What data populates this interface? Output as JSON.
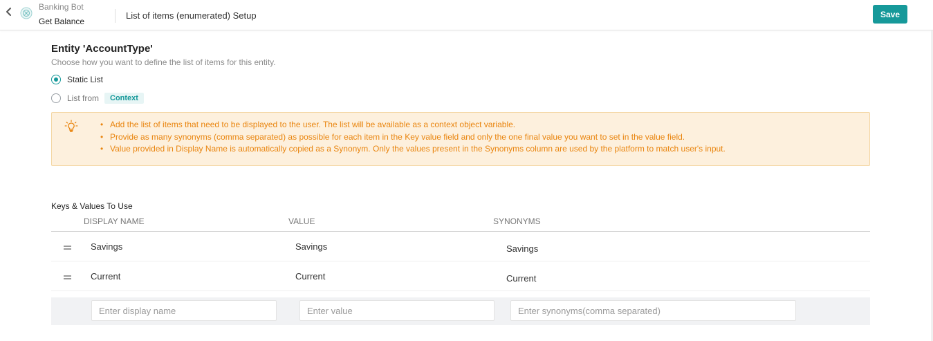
{
  "header": {
    "bot_name": "Banking Bot",
    "task_name": "Get Balance",
    "page_title": "List of items (enumerated) Setup",
    "save_label": "Save",
    "accent_color": "#16999a"
  },
  "entity": {
    "title": "Entity 'AccountType'",
    "subtitle": "Choose how you want to define the list of items for this entity.",
    "options": [
      {
        "label": "Static List",
        "selected": true
      },
      {
        "label": "List from",
        "selected": false,
        "tag": "Context"
      }
    ]
  },
  "info": {
    "icon": "lightbulb-icon",
    "items": [
      "Add the list of items that need to be displayed to the user. The list will be available as a context object variable.",
      "Provide as many synonyms (comma separated) as possible for each item in the Key value field and only the one final value you want to set in the value field.",
      "Value provided in Display Name is automatically copied as a Synonym. Only the values present in the Synonyms column are used by the platform to match user's input."
    ],
    "text_color": "#e9850f",
    "bg_color": "#fdf0dd"
  },
  "table": {
    "title": "Keys & Values To Use",
    "columns": [
      "DISPLAY NAME",
      "VALUE",
      "SYNONYMS"
    ],
    "rows": [
      {
        "display_name": "Savings",
        "value": "Savings",
        "synonyms": "Savings"
      },
      {
        "display_name": "Current",
        "value": "Current",
        "synonyms": "Current"
      }
    ],
    "new_row": {
      "display_placeholder": "Enter display name",
      "value_placeholder": "Enter value",
      "synonyms_placeholder": "Enter synonyms(comma separated)"
    }
  }
}
